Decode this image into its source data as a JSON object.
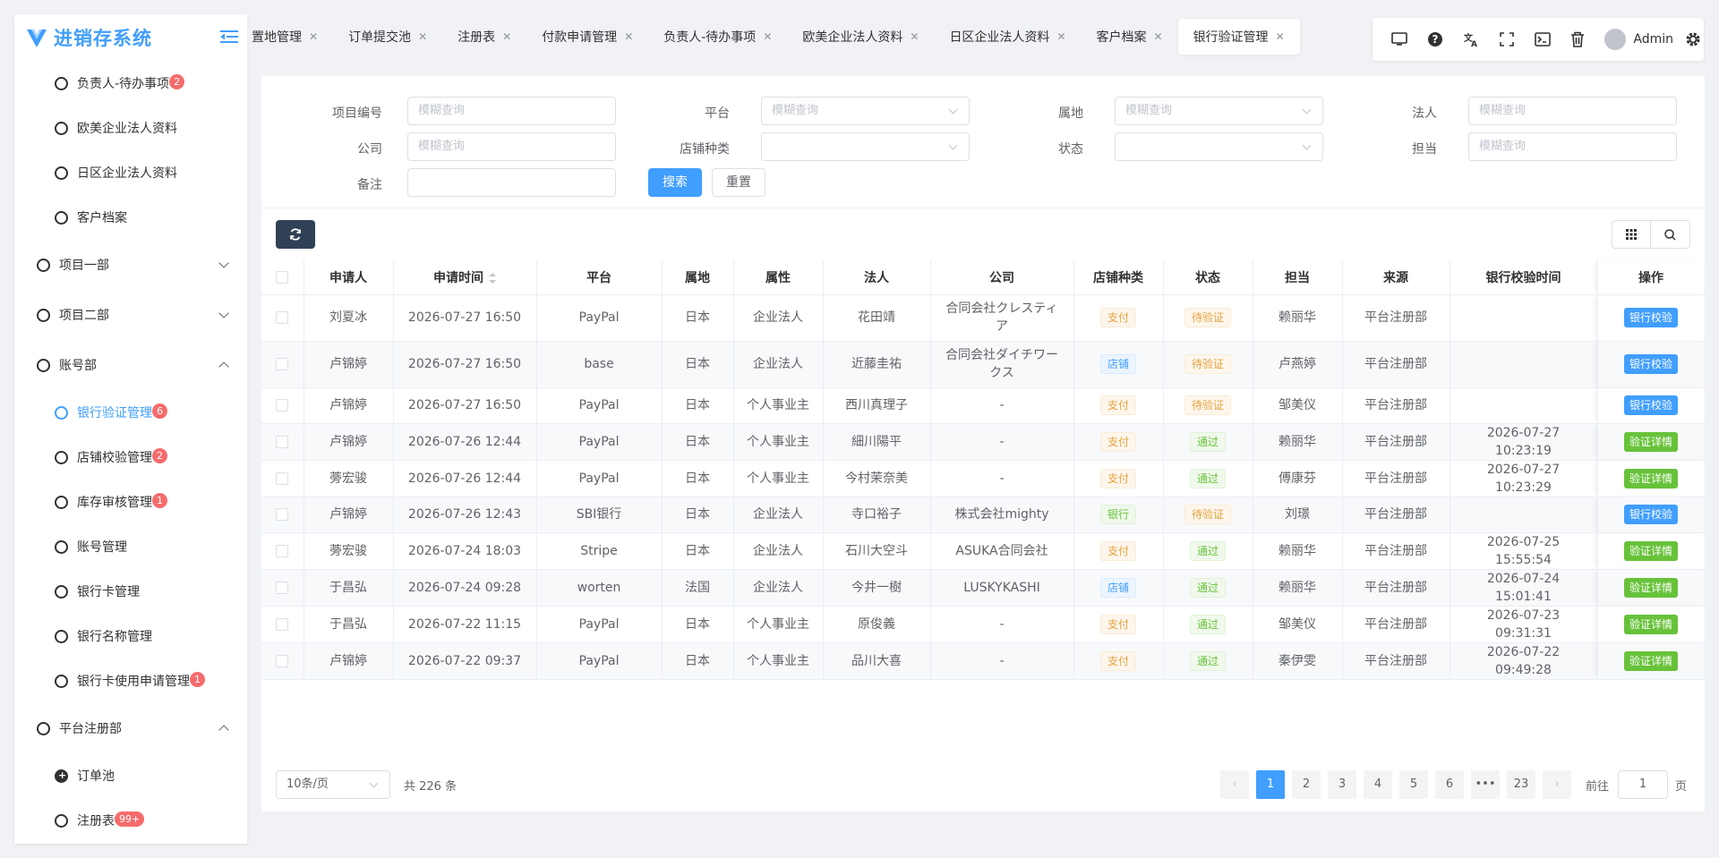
{
  "app": {
    "title": "进销存系统"
  },
  "sidebar": {
    "items": [
      {
        "label": "负责人-待办事项",
        "badge": "2",
        "level": "sub"
      },
      {
        "label": "欧美企业法人资料",
        "badge": "",
        "level": "sub"
      },
      {
        "label": "日区企业法人资料",
        "badge": "",
        "level": "sub"
      },
      {
        "label": "客户档案",
        "badge": "",
        "level": "sub"
      },
      {
        "label": "项目一部",
        "badge": "",
        "level": "top",
        "chevron": "down"
      },
      {
        "label": "项目二部",
        "badge": "",
        "level": "top",
        "chevron": "down"
      },
      {
        "label": "账号部",
        "badge": "",
        "level": "top",
        "chevron": "up"
      },
      {
        "label": "银行验证管理",
        "badge": "6",
        "level": "sub",
        "active": true
      },
      {
        "label": "店铺校验管理",
        "badge": "2",
        "level": "sub"
      },
      {
        "label": "库存审核管理",
        "badge": "1",
        "level": "sub"
      },
      {
        "label": "账号管理",
        "badge": "",
        "level": "sub"
      },
      {
        "label": "银行卡管理",
        "badge": "",
        "level": "sub"
      },
      {
        "label": "银行名称管理",
        "badge": "",
        "level": "sub"
      },
      {
        "label": "银行卡使用申请管理",
        "badge": "1",
        "level": "sub"
      },
      {
        "label": "平台注册部",
        "badge": "",
        "level": "top",
        "chevron": "up"
      },
      {
        "label": "订单池",
        "badge": "",
        "level": "sub",
        "filled": true
      },
      {
        "label": "注册表",
        "badge": "99+",
        "level": "sub"
      }
    ]
  },
  "tabs": [
    {
      "label": "置地管理"
    },
    {
      "label": "订单提交池"
    },
    {
      "label": "注册表"
    },
    {
      "label": "付款申请管理"
    },
    {
      "label": "负责人-待办事项"
    },
    {
      "label": "欧美企业法人资料"
    },
    {
      "label": "日区企业法人资料"
    },
    {
      "label": "客户档案"
    },
    {
      "label": "银行验证管理",
      "active": true
    }
  ],
  "toolbar": {
    "user": "Admin"
  },
  "filters": {
    "project_no": {
      "label": "项目编号",
      "placeholder": "模糊查询"
    },
    "platform": {
      "label": "平台",
      "placeholder": "模糊查询"
    },
    "region": {
      "label": "属地",
      "placeholder": "模糊查询"
    },
    "legal_person": {
      "label": "法人",
      "placeholder": "模糊查询"
    },
    "company": {
      "label": "公司",
      "placeholder": "模糊查询"
    },
    "store_type": {
      "label": "店铺种类",
      "placeholder": ""
    },
    "status": {
      "label": "状态",
      "placeholder": ""
    },
    "owner": {
      "label": "担当",
      "placeholder": "模糊查询"
    },
    "remark": {
      "label": "备注",
      "placeholder": ""
    },
    "search_label": "搜索",
    "reset_label": "重置"
  },
  "table": {
    "columns": [
      "申请人",
      "申请时间",
      "平台",
      "属地",
      "属性",
      "法人",
      "公司",
      "店铺种类",
      "状态",
      "担当",
      "来源",
      "银行校验时间",
      "操作"
    ],
    "rows": [
      {
        "applicant": "刘夏冰",
        "time": "2026-07-27 16:50",
        "platform": "PayPal",
        "region": "日本",
        "attr": "企业法人",
        "legal": "花田靖",
        "company": "合同会社クレスティア",
        "store_type": "支付",
        "store_tag": "warn",
        "status": "待验证",
        "status_tag": "warn",
        "owner": "赖丽华",
        "source": "平台注册部",
        "verify_time": "",
        "op": "银行校验",
        "op_style": "blue"
      },
      {
        "applicant": "卢锦婷",
        "time": "2026-07-27 16:50",
        "platform": "base",
        "region": "日本",
        "attr": "企业法人",
        "legal": "近藤圭祐",
        "company": "合同会社ダイチワークス",
        "store_type": "店铺",
        "store_tag": "info",
        "status": "待验证",
        "status_tag": "warn",
        "owner": "卢燕婷",
        "source": "平台注册部",
        "verify_time": "",
        "op": "银行校验",
        "op_style": "blue"
      },
      {
        "applicant": "卢锦婷",
        "time": "2026-07-27 16:50",
        "platform": "PayPal",
        "region": "日本",
        "attr": "个人事业主",
        "legal": "西川真理子",
        "company": "-",
        "store_type": "支付",
        "store_tag": "warn",
        "status": "待验证",
        "status_tag": "warn",
        "owner": "邹美仪",
        "source": "平台注册部",
        "verify_time": "",
        "op": "银行校验",
        "op_style": "blue"
      },
      {
        "applicant": "卢锦婷",
        "time": "2026-07-26 12:44",
        "platform": "PayPal",
        "region": "日本",
        "attr": "个人事业主",
        "legal": "細川陽平",
        "company": "-",
        "store_type": "支付",
        "store_tag": "warn",
        "status": "通过",
        "status_tag": "ok",
        "owner": "赖丽华",
        "source": "平台注册部",
        "verify_time": "2026-07-27 10:23:19",
        "op": "验证详情",
        "op_style": "green"
      },
      {
        "applicant": "蒡宏骏",
        "time": "2026-07-26 12:44",
        "platform": "PayPal",
        "region": "日本",
        "attr": "个人事业主",
        "legal": "今村茉奈美",
        "company": "-",
        "store_type": "支付",
        "store_tag": "warn",
        "status": "通过",
        "status_tag": "ok",
        "owner": "傅康芬",
        "source": "平台注册部",
        "verify_time": "2026-07-27 10:23:29",
        "op": "验证详情",
        "op_style": "green"
      },
      {
        "applicant": "卢锦婷",
        "time": "2026-07-26 12:43",
        "platform": "SBI银行",
        "region": "日本",
        "attr": "企业法人",
        "legal": "寺口裕子",
        "company": "株式会社mighty",
        "store_type": "银行",
        "store_tag": "ok",
        "status": "待验证",
        "status_tag": "warn",
        "owner": "刘璟",
        "source": "平台注册部",
        "verify_time": "",
        "op": "银行校验",
        "op_style": "blue"
      },
      {
        "applicant": "蒡宏骏",
        "time": "2026-07-24 18:03",
        "platform": "Stripe",
        "region": "日本",
        "attr": "企业法人",
        "legal": "石川大空斗",
        "company": "ASUKA合同会社",
        "store_type": "支付",
        "store_tag": "warn",
        "status": "通过",
        "status_tag": "ok",
        "owner": "赖丽华",
        "source": "平台注册部",
        "verify_time": "2026-07-25 15:55:54",
        "op": "验证详情",
        "op_style": "green"
      },
      {
        "applicant": "于昌弘",
        "time": "2026-07-24 09:28",
        "platform": "worten",
        "region": "法国",
        "attr": "企业法人",
        "legal": "今井一樹",
        "company": "LUSKYKASHI",
        "store_type": "店铺",
        "store_tag": "info",
        "status": "通过",
        "status_tag": "ok",
        "owner": "赖丽华",
        "source": "平台注册部",
        "verify_time": "2026-07-24 15:01:41",
        "op": "验证详情",
        "op_style": "green"
      },
      {
        "applicant": "于昌弘",
        "time": "2026-07-22 11:15",
        "platform": "PayPal",
        "region": "日本",
        "attr": "个人事业主",
        "legal": "原俊義",
        "company": "-",
        "store_type": "支付",
        "store_tag": "warn",
        "status": "通过",
        "status_tag": "ok",
        "owner": "邹美仪",
        "source": "平台注册部",
        "verify_time": "2026-07-23 09:31:31",
        "op": "验证详情",
        "op_style": "green"
      },
      {
        "applicant": "卢锦婷",
        "time": "2026-07-22 09:37",
        "platform": "PayPal",
        "region": "日本",
        "attr": "个人事业主",
        "legal": "品川大喜",
        "company": "-",
        "store_type": "支付",
        "store_tag": "warn",
        "status": "通过",
        "status_tag": "ok",
        "owner": "秦伊雯",
        "source": "平台注册部",
        "verify_time": "2026-07-22 09:49:28",
        "op": "验证详情",
        "op_style": "green"
      }
    ]
  },
  "pagination": {
    "page_size": "10条/页",
    "total": "共 226 条",
    "pages": [
      "1",
      "2",
      "3",
      "4",
      "5",
      "6",
      "•••",
      "23"
    ],
    "current": "1",
    "goto_label": "前往",
    "goto_value": "1",
    "goto_unit": "页"
  },
  "colors": {
    "primary": "#409eff",
    "success": "#67c23a",
    "warning": "#e6a23c",
    "danger": "#f56c6c",
    "dark": "#304156"
  }
}
